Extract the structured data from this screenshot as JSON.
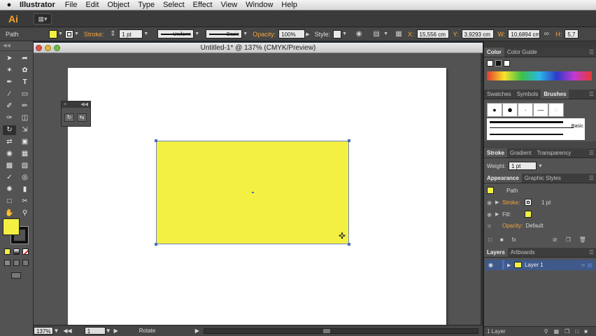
{
  "menubar": {
    "app_name": "Illustrator",
    "items": [
      "File",
      "Edit",
      "Object",
      "Type",
      "Select",
      "Effect",
      "View",
      "Window",
      "Help"
    ]
  },
  "appbar": {
    "logo": "Ai",
    "workspace_icon": "arrange-documents-icon"
  },
  "control": {
    "selection_type": "Path",
    "stroke_label": "Stroke:",
    "stroke_weight": "1 pt",
    "profile": "Uniform",
    "brush": "Basic",
    "opacity_label": "Opacity:",
    "opacity": "100%",
    "style_label": "Style:",
    "x_label": "X:",
    "x": "15,556 cm",
    "y_label": "Y:",
    "y": "3,9293 cm",
    "w_label": "W:",
    "w": "10,6894 cm",
    "h_label": "H:",
    "h": "5,7",
    "fill_color": "#f4f042"
  },
  "document": {
    "title": "Untitled-1* @ 137% (CMYK/Preview)",
    "shape_fill": "#f4f042",
    "selection_color": "#4e6db6"
  },
  "status": {
    "zoom": "137%",
    "page": "1",
    "tool": "Rotate"
  },
  "panels": {
    "color": {
      "tabs": [
        "Color",
        "Color Guide"
      ]
    },
    "brushes": {
      "tabs": [
        "Swatches",
        "Symbols",
        "Brushes"
      ],
      "basic_label": "Basic"
    },
    "stroke": {
      "tabs": [
        "Stroke",
        "Gradient",
        "Transparency"
      ],
      "weight_label": "Weight:",
      "weight": "1 pt"
    },
    "appearance": {
      "tabs": [
        "Appearance",
        "Graphic Styles"
      ],
      "object": "Path",
      "stroke_label": "Stroke:",
      "stroke_value": "1 pt",
      "fill_label": "Fill:",
      "opacity_label": "Opacity:",
      "opacity_value": "Default"
    },
    "layers": {
      "tabs": [
        "Layers",
        "Artboards"
      ],
      "layer_name": "Layer 1",
      "footer": "1 Layer"
    }
  }
}
